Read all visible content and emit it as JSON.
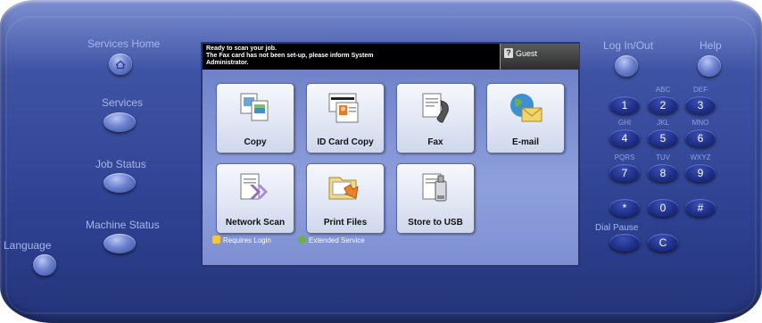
{
  "left_panel": {
    "services_home_label": "Services Home",
    "services_label": "Services",
    "job_status_label": "Job Status",
    "machine_status_label": "Machine Status",
    "language_label": "Language"
  },
  "screen": {
    "message_line1": "Ready to scan your job.",
    "message_line2": "The Fax card has not been set-up, please inform System",
    "message_line3": "Administrator.",
    "guest_label": "Guest",
    "guest_icon": "?",
    "tiles": [
      {
        "label": "Copy",
        "icon": "copy-icon"
      },
      {
        "label": "ID Card Copy",
        "icon": "id-card-icon"
      },
      {
        "label": "Fax",
        "icon": "fax-icon"
      },
      {
        "label": "E-mail",
        "icon": "email-icon"
      },
      {
        "label": "Network Scan",
        "icon": "network-scan-icon"
      },
      {
        "label": "Print Files",
        "icon": "print-files-icon"
      },
      {
        "label": "Store to USB",
        "icon": "usb-icon"
      }
    ],
    "legend_requires_login": "Requires Login",
    "legend_extended_service": "Extended Service"
  },
  "right_panel": {
    "login_label": "Log In/Out",
    "help_label": "Help",
    "keys": [
      "1",
      "2",
      "3",
      "4",
      "5",
      "6",
      "7",
      "8",
      "9",
      "*",
      "0",
      "#"
    ],
    "key_letters": {
      "2": "ABC",
      "3": "DEF",
      "4": "GHI",
      "5": "JKL",
      "6": "MNO",
      "7": "PQRS",
      "8": "TUV",
      "9": "WXYZ"
    },
    "dial_pause_label": "Dial Pause",
    "clear_key": "C"
  },
  "colors": {
    "panel_blue": "#3f53a5",
    "screen_blue": "#8a9ad8",
    "key_blue": "#1d2d84"
  }
}
